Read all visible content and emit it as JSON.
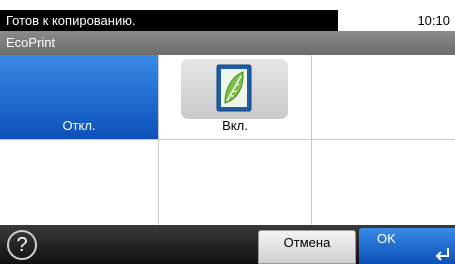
{
  "status": {
    "message": "Готов к копированию.",
    "time": "10:10"
  },
  "title": "EcoPrint",
  "options": [
    {
      "label": "Откл.",
      "selected": true
    },
    {
      "label": "Вкл.",
      "selected": false,
      "icon": "leaf-icon"
    }
  ],
  "bottom": {
    "help_label": "?",
    "cancel_label": "Отмена",
    "ok_label": "OK"
  },
  "colors": {
    "accent_blue": "#1a63cc",
    "status_bar": "#000000",
    "title_bar": "#7a7a7a"
  }
}
